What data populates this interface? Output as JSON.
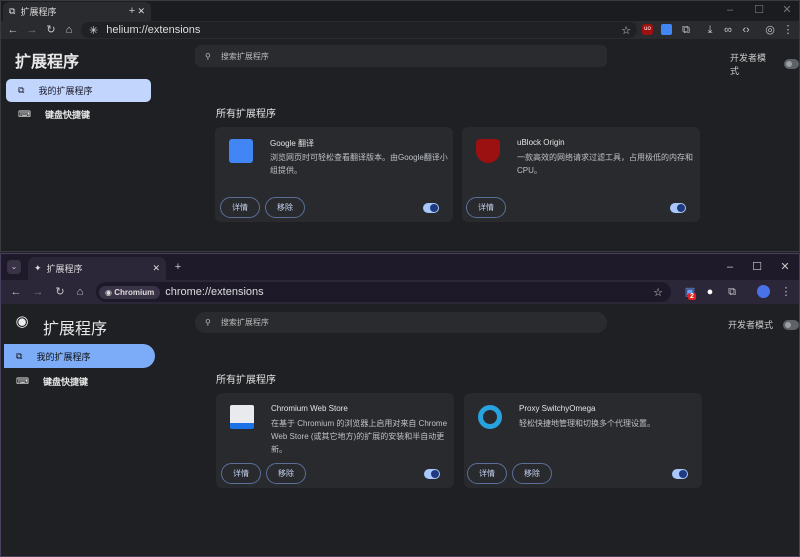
{
  "window1": {
    "tab_title": "扩展程序",
    "url": "helium://extensions",
    "page_title": "扩展程序",
    "search_placeholder": "搜索扩展程序",
    "dev_mode_label": "开发者模式",
    "nav": [
      {
        "label": "我的扩展程序",
        "active": true
      },
      {
        "label": "键盘快捷键"
      }
    ],
    "section_title": "所有扩展程序",
    "extensions": [
      {
        "name": "Google 翻译",
        "description": "浏览网页时可轻松查看翻译版本。由Google翻译小组提供。",
        "details": "详情",
        "remove": "移除",
        "enabled": true
      },
      {
        "name": "uBlock Origin",
        "description": "一款高效的网络请求过滤工具，占用极低的内存和CPU。",
        "details": "详情",
        "enabled": true
      }
    ],
    "colors": {
      "active_nav": "#c2d5fd",
      "accent": "#a8c7fa"
    }
  },
  "window2": {
    "tab_title": "扩展程序",
    "chip": "Chromium",
    "url": "chrome://extensions",
    "badge": "2",
    "page_title": "扩展程序",
    "search_placeholder": "搜索扩展程序",
    "dev_mode_label": "开发者模式",
    "nav": [
      {
        "label": "我的扩展程序",
        "active": true
      },
      {
        "label": "键盘快捷键"
      }
    ],
    "section_title": "所有扩展程序",
    "extensions": [
      {
        "name": "Chromium Web Store",
        "description": "在基于 Chromium 的浏览器上启用对来自 Chrome Web Store (或其它地方)的扩展的安装和半自动更新。",
        "details": "详情",
        "remove": "移除",
        "enabled": true
      },
      {
        "name": "Proxy SwitchyOmega",
        "description": "轻松快捷地管理和切换多个代理设置。",
        "details": "详情",
        "remove": "移除",
        "enabled": true
      }
    ],
    "colors": {
      "active_nav": "#7cacf8",
      "accent": "#a8c7fa"
    }
  }
}
